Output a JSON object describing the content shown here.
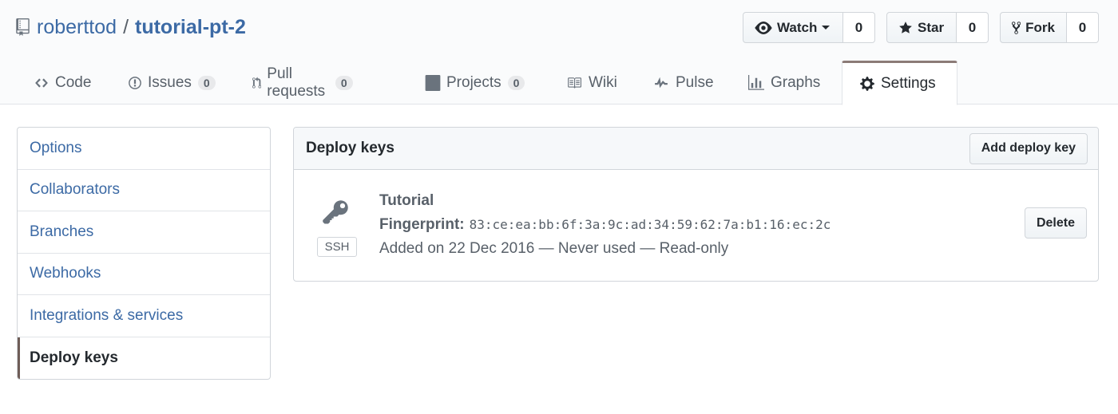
{
  "repo": {
    "owner": "roberttod",
    "separator": "/",
    "name": "tutorial-pt-2"
  },
  "actions": {
    "watch": {
      "label": "Watch",
      "count": "0"
    },
    "star": {
      "label": "Star",
      "count": "0"
    },
    "fork": {
      "label": "Fork",
      "count": "0"
    }
  },
  "tabs": [
    {
      "label": "Code",
      "icon": "code-icon"
    },
    {
      "label": "Issues",
      "counter": "0",
      "icon": "issue-opened-icon"
    },
    {
      "label": "Pull requests",
      "counter": "0",
      "icon": "git-pull-request-icon"
    },
    {
      "label": "Projects",
      "counter": "0",
      "icon": "project-icon"
    },
    {
      "label": "Wiki",
      "icon": "book-icon"
    },
    {
      "label": "Pulse",
      "icon": "pulse-icon"
    },
    {
      "label": "Graphs",
      "icon": "graph-icon"
    },
    {
      "label": "Settings",
      "icon": "gear-icon",
      "selected": true
    }
  ],
  "sidebar": {
    "items": [
      {
        "label": "Options"
      },
      {
        "label": "Collaborators"
      },
      {
        "label": "Branches"
      },
      {
        "label": "Webhooks"
      },
      {
        "label": "Integrations & services"
      },
      {
        "label": "Deploy keys",
        "selected": true
      }
    ]
  },
  "deploy_keys": {
    "title": "Deploy keys",
    "add_button": "Add deploy key",
    "keys": [
      {
        "title": "Tutorial",
        "type_label": "SSH",
        "fingerprint_label": "Fingerprint:",
        "fingerprint": "83:ce:ea:bb:6f:3a:9c:ad:34:59:62:7a:b1:16:ec:2c",
        "meta": "Added on 22 Dec 2016 — Never used — Read-only",
        "delete_label": "Delete"
      }
    ]
  },
  "colors": {
    "link": "#3c6aa5",
    "selected_accent": "#8c7b77",
    "text_muted": "#586069"
  }
}
